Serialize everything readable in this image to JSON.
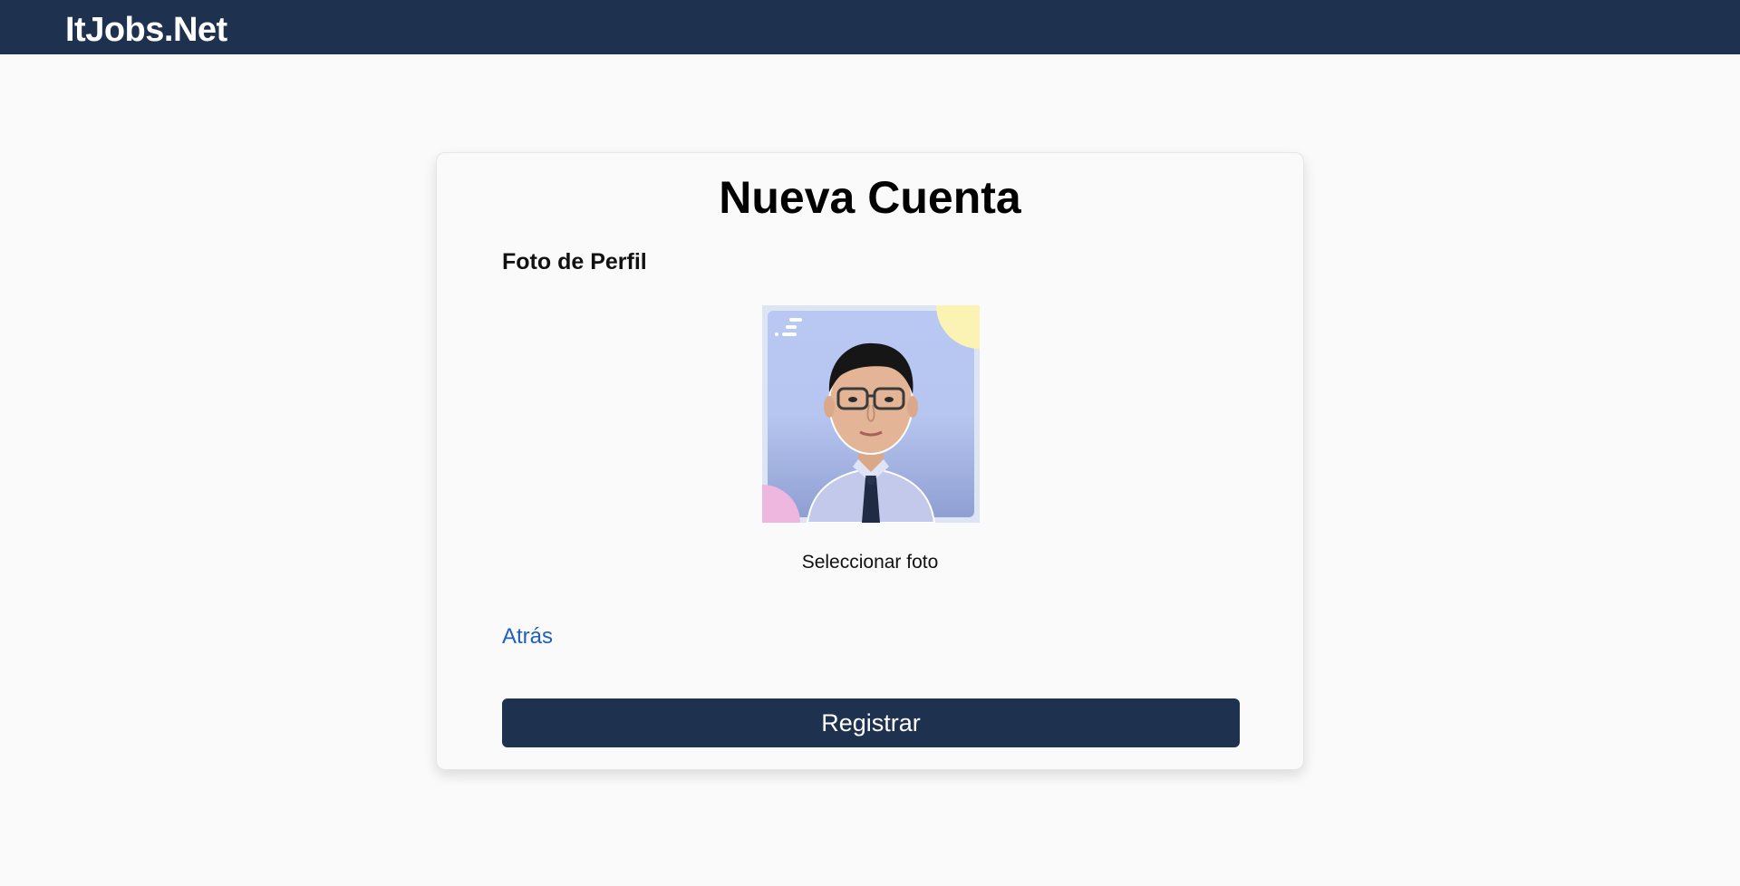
{
  "header": {
    "brand": "ItJobs.Net"
  },
  "form": {
    "title": "Nueva Cuenta",
    "photo_section_label": "Foto de Perfil",
    "select_photo_label": "Seleccionar foto",
    "back_link_label": "Atrás",
    "register_button_label": "Registrar"
  },
  "colors": {
    "navbar": "#1e3250",
    "button": "#1e3250",
    "link": "#1f5fbf",
    "background": "#fafafa"
  }
}
